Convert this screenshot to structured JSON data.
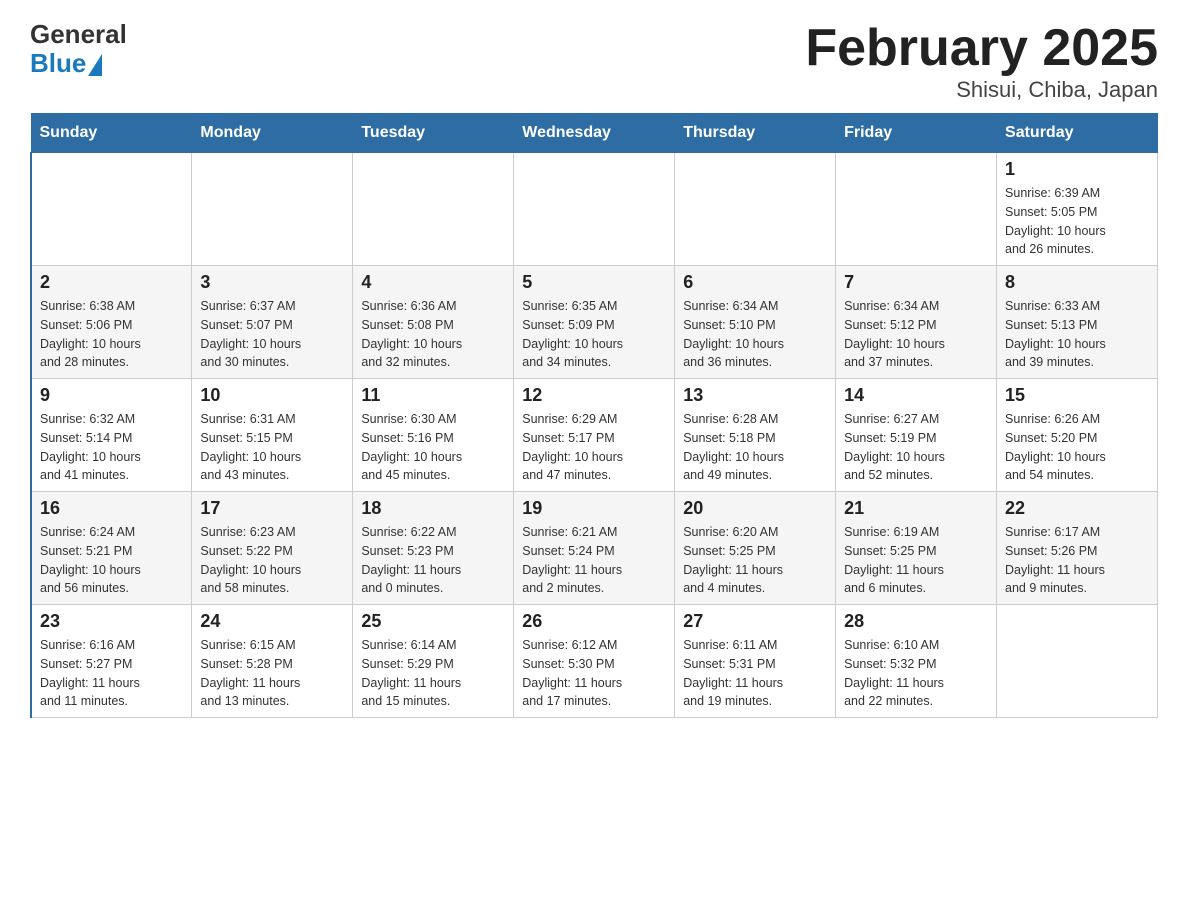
{
  "header": {
    "logo_general": "General",
    "logo_blue": "Blue",
    "title": "February 2025",
    "subtitle": "Shisui, Chiba, Japan"
  },
  "days_of_week": [
    "Sunday",
    "Monday",
    "Tuesday",
    "Wednesday",
    "Thursday",
    "Friday",
    "Saturday"
  ],
  "weeks": [
    [
      {
        "day": "",
        "info": ""
      },
      {
        "day": "",
        "info": ""
      },
      {
        "day": "",
        "info": ""
      },
      {
        "day": "",
        "info": ""
      },
      {
        "day": "",
        "info": ""
      },
      {
        "day": "",
        "info": ""
      },
      {
        "day": "1",
        "info": "Sunrise: 6:39 AM\nSunset: 5:05 PM\nDaylight: 10 hours\nand 26 minutes."
      }
    ],
    [
      {
        "day": "2",
        "info": "Sunrise: 6:38 AM\nSunset: 5:06 PM\nDaylight: 10 hours\nand 28 minutes."
      },
      {
        "day": "3",
        "info": "Sunrise: 6:37 AM\nSunset: 5:07 PM\nDaylight: 10 hours\nand 30 minutes."
      },
      {
        "day": "4",
        "info": "Sunrise: 6:36 AM\nSunset: 5:08 PM\nDaylight: 10 hours\nand 32 minutes."
      },
      {
        "day": "5",
        "info": "Sunrise: 6:35 AM\nSunset: 5:09 PM\nDaylight: 10 hours\nand 34 minutes."
      },
      {
        "day": "6",
        "info": "Sunrise: 6:34 AM\nSunset: 5:10 PM\nDaylight: 10 hours\nand 36 minutes."
      },
      {
        "day": "7",
        "info": "Sunrise: 6:34 AM\nSunset: 5:12 PM\nDaylight: 10 hours\nand 37 minutes."
      },
      {
        "day": "8",
        "info": "Sunrise: 6:33 AM\nSunset: 5:13 PM\nDaylight: 10 hours\nand 39 minutes."
      }
    ],
    [
      {
        "day": "9",
        "info": "Sunrise: 6:32 AM\nSunset: 5:14 PM\nDaylight: 10 hours\nand 41 minutes."
      },
      {
        "day": "10",
        "info": "Sunrise: 6:31 AM\nSunset: 5:15 PM\nDaylight: 10 hours\nand 43 minutes."
      },
      {
        "day": "11",
        "info": "Sunrise: 6:30 AM\nSunset: 5:16 PM\nDaylight: 10 hours\nand 45 minutes."
      },
      {
        "day": "12",
        "info": "Sunrise: 6:29 AM\nSunset: 5:17 PM\nDaylight: 10 hours\nand 47 minutes."
      },
      {
        "day": "13",
        "info": "Sunrise: 6:28 AM\nSunset: 5:18 PM\nDaylight: 10 hours\nand 49 minutes."
      },
      {
        "day": "14",
        "info": "Sunrise: 6:27 AM\nSunset: 5:19 PM\nDaylight: 10 hours\nand 52 minutes."
      },
      {
        "day": "15",
        "info": "Sunrise: 6:26 AM\nSunset: 5:20 PM\nDaylight: 10 hours\nand 54 minutes."
      }
    ],
    [
      {
        "day": "16",
        "info": "Sunrise: 6:24 AM\nSunset: 5:21 PM\nDaylight: 10 hours\nand 56 minutes."
      },
      {
        "day": "17",
        "info": "Sunrise: 6:23 AM\nSunset: 5:22 PM\nDaylight: 10 hours\nand 58 minutes."
      },
      {
        "day": "18",
        "info": "Sunrise: 6:22 AM\nSunset: 5:23 PM\nDaylight: 11 hours\nand 0 minutes."
      },
      {
        "day": "19",
        "info": "Sunrise: 6:21 AM\nSunset: 5:24 PM\nDaylight: 11 hours\nand 2 minutes."
      },
      {
        "day": "20",
        "info": "Sunrise: 6:20 AM\nSunset: 5:25 PM\nDaylight: 11 hours\nand 4 minutes."
      },
      {
        "day": "21",
        "info": "Sunrise: 6:19 AM\nSunset: 5:25 PM\nDaylight: 11 hours\nand 6 minutes."
      },
      {
        "day": "22",
        "info": "Sunrise: 6:17 AM\nSunset: 5:26 PM\nDaylight: 11 hours\nand 9 minutes."
      }
    ],
    [
      {
        "day": "23",
        "info": "Sunrise: 6:16 AM\nSunset: 5:27 PM\nDaylight: 11 hours\nand 11 minutes."
      },
      {
        "day": "24",
        "info": "Sunrise: 6:15 AM\nSunset: 5:28 PM\nDaylight: 11 hours\nand 13 minutes."
      },
      {
        "day": "25",
        "info": "Sunrise: 6:14 AM\nSunset: 5:29 PM\nDaylight: 11 hours\nand 15 minutes."
      },
      {
        "day": "26",
        "info": "Sunrise: 6:12 AM\nSunset: 5:30 PM\nDaylight: 11 hours\nand 17 minutes."
      },
      {
        "day": "27",
        "info": "Sunrise: 6:11 AM\nSunset: 5:31 PM\nDaylight: 11 hours\nand 19 minutes."
      },
      {
        "day": "28",
        "info": "Sunrise: 6:10 AM\nSunset: 5:32 PM\nDaylight: 11 hours\nand 22 minutes."
      },
      {
        "day": "",
        "info": ""
      }
    ]
  ]
}
